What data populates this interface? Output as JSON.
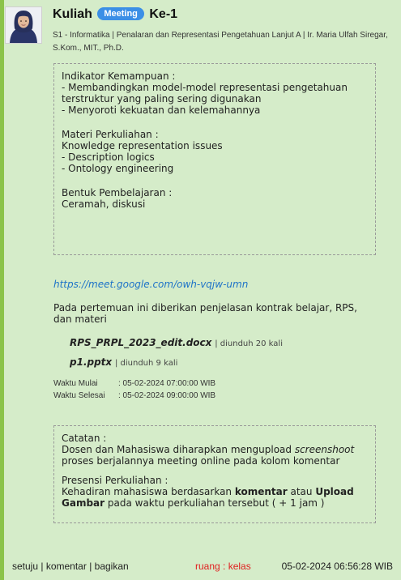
{
  "colors": {
    "accent": "#8bc34a",
    "badge": "#3b8fe6",
    "link": "#1e73c8",
    "room": "#e02020",
    "background": "#d5ecc9"
  },
  "header": {
    "title_prefix": "Kuliah",
    "badge": "Meeting",
    "title_suffix": "Ke-1",
    "subtitle": "S1 - Informatika | Penalaran dan Representasi Pengetahuan Lanjut A | Ir. Maria Ulfah Siregar, S.Kom., MIT., Ph.D."
  },
  "details": {
    "indikator_heading": "Indikator Kemampuan :",
    "indikator_items": [
      "- Membandingkan model-model representasi pengetahuan terstruktur yang paling sering digunakan",
      "- Menyoroti kekuatan dan kelemahannya"
    ],
    "materi_heading": "Materi Perkuliahan :",
    "materi_items": [
      "Knowledge representation issues",
      "- Description logics",
      "- Ontology engineering"
    ],
    "bentuk_heading": "Bentuk Pembelajaran :",
    "bentuk_text": "Ceramah, diskusi"
  },
  "meeting_link": "https://meet.google.com/owh-vqjw-umn",
  "description": "Pada pertemuan ini diberikan penjelasan kontrak belajar, RPS, dan materi",
  "files": [
    {
      "name": "RPS_PRPL_2023_edit.docx",
      "downloads": "| diunduh 20 kali"
    },
    {
      "name": "p1.pptx",
      "downloads": "| diunduh 9 kali"
    }
  ],
  "schedule": {
    "start_label": "Waktu Mulai",
    "start_value": ": 05-02-2024 07:00:00 WIB",
    "end_label": "Waktu Selesai",
    "end_value": ": 05-02-2024 09:00:00 WIB"
  },
  "notes": {
    "catatan_heading": "Catatan :",
    "catatan_before": "Dosen dan Mahasiswa diharapkan mengupload ",
    "catatan_em": "screenshoot",
    "catatan_after": " proses berjalannya meeting online pada kolom komentar",
    "presensi_heading": "Presensi Perkuliahan :",
    "presensi_1": "Kehadiran mahasiswa berdasarkan ",
    "presensi_b1": "komentar",
    "presensi_2": " atau ",
    "presensi_b2": "Upload Gambar",
    "presensi_3": " pada waktu perkuliahan tersebut ( + 1 jam )"
  },
  "footer": {
    "setuju": "setuju",
    "sep": " | ",
    "komentar": "komentar",
    "bagikan": "bagikan",
    "room": "ruang : kelas",
    "timestamp": "05-02-2024 06:56:28 WIB"
  },
  "icons": {
    "avatar": "lecturer-avatar"
  }
}
